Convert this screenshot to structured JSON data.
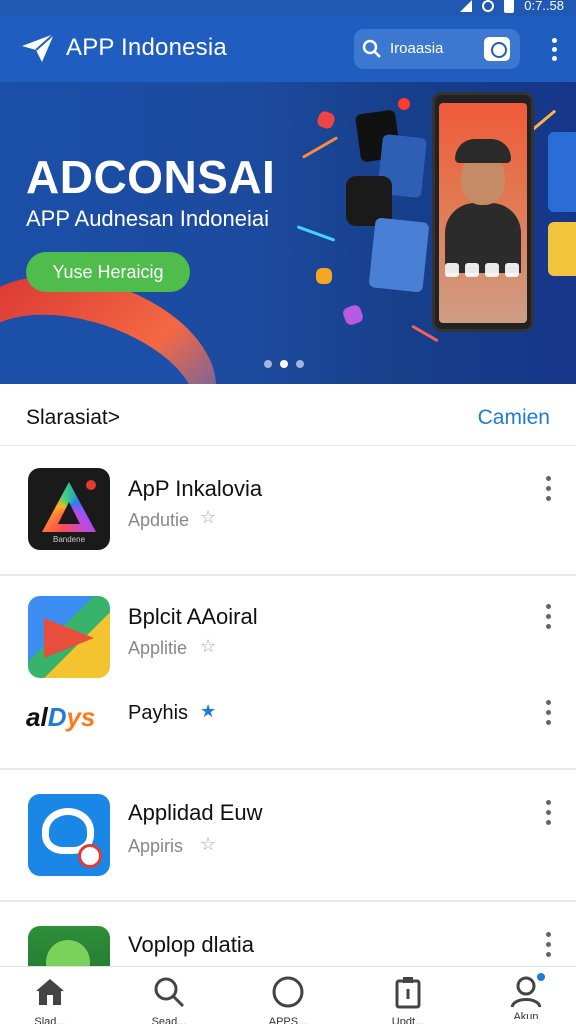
{
  "status_bar": {
    "time": "0:7..58"
  },
  "app_bar": {
    "title": "APP Indonesia",
    "search_value": "Iroaasia"
  },
  "banner": {
    "title": "ADCONSAI",
    "subtitle": "APP Audnesan Indoneiai",
    "cta": "Yuse Heraicig",
    "page_count": 3,
    "active_page": 2
  },
  "section": {
    "title": "Slarasiat>",
    "link": "Camien"
  },
  "apps": [
    {
      "name": "ApP Inkalovia",
      "category": "Apdutie",
      "icon": "colorful-triangle-icon",
      "star": "☆"
    },
    {
      "name": "Bplcit AAoiral",
      "category": "Applitie",
      "icon": "play-triangle-icon",
      "star": "☆"
    },
    {
      "name": "Payhis",
      "brand": {
        "p1": "al",
        "p2": "D",
        "p3": "ys"
      },
      "icon": "aldeys-logo-icon",
      "star": "★"
    },
    {
      "name": "Applidad Euw",
      "category": "Appiris",
      "icon": "heart-chat-icon",
      "star": "☆"
    },
    {
      "name": "Voplop dlatia",
      "icon": "green-leaf-icon"
    }
  ],
  "bottom_nav": [
    {
      "label": "Slad...",
      "icon": "home-icon"
    },
    {
      "label": "Sead...",
      "icon": "search-icon"
    },
    {
      "label": "APPS...",
      "icon": "circle-icon"
    },
    {
      "label": "Updt...",
      "icon": "clipboard-icon"
    },
    {
      "label": "Akun",
      "icon": "profile-icon"
    }
  ],
  "colors": {
    "primary": "#1f5ec0",
    "accent_link": "#1e7bd6",
    "cta_green": "#4fbd4c"
  }
}
